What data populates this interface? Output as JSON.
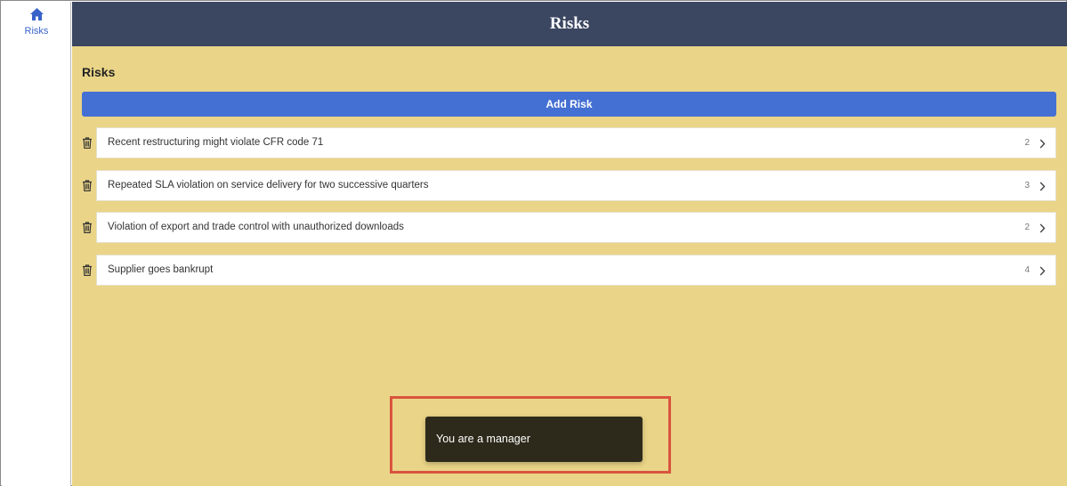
{
  "sidebar": {
    "items": [
      {
        "label": "Risks",
        "icon": "home-icon"
      }
    ],
    "accent_color": "#3a63c9"
  },
  "header": {
    "title": "Risks",
    "background": "#3b4661"
  },
  "main": {
    "section_title": "Risks",
    "add_button_label": "Add Risk",
    "background": "#ead487",
    "button_color": "#4470d3",
    "risks": [
      {
        "title": "Recent restructuring might violate CFR code 71",
        "count": "2"
      },
      {
        "title": "Repeated SLA violation on service delivery for two successive quarters",
        "count": "3"
      },
      {
        "title": "Violation of export and trade control with unauthorized downloads",
        "count": "2"
      },
      {
        "title": "Supplier goes bankrupt",
        "count": "4"
      }
    ]
  },
  "toast": {
    "message": "You are a manager",
    "background": "#2e2a1b",
    "highlight_color": "#d9543e"
  }
}
